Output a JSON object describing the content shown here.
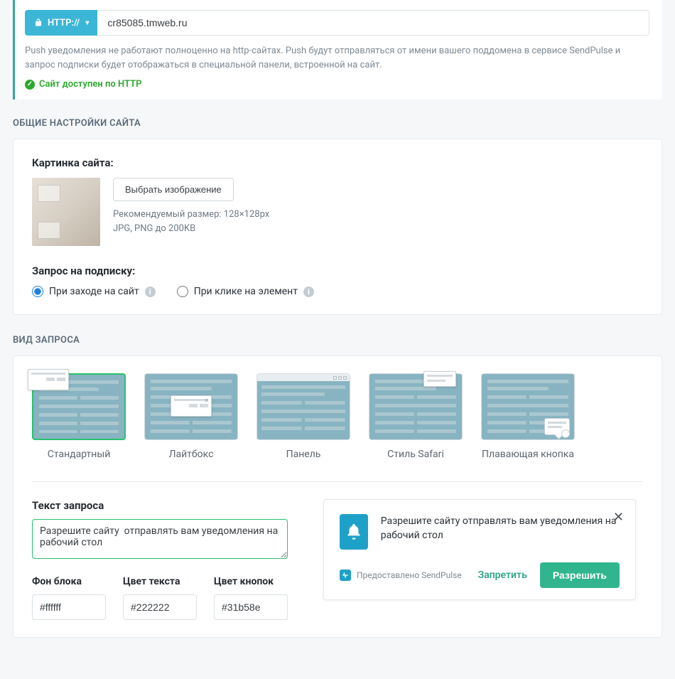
{
  "http": {
    "badge_label": "HTTP://",
    "url": "cr85085.tmweb.ru",
    "note": "Push уведомления не работают полноценно на http-сайтах. Push будут отправляться от имени вашего поддомена в сервисе SendPulse и запрос подписки будет отображаться в специальной панели, встроенной на сайт.",
    "status": "Сайт доступен по HTTP"
  },
  "sections": {
    "general": "ОБЩИЕ НАСТРОЙКИ САЙТА",
    "view": "ВИД ЗАПРОСА"
  },
  "image_block": {
    "heading": "Картинка сайта:",
    "choose_button": "Выбрать изображение",
    "rec_size": "Рекомендуемый размер: 128×128px",
    "rec_filetypes": "JPG, PNG до 200KB"
  },
  "subscribe": {
    "heading": "Запрос на подписку:",
    "opt_onload": "При заходе на сайт",
    "opt_onclick": "При клике на элемент"
  },
  "variants": {
    "standard": "Стандартный",
    "lightbox": "Лайтбокс",
    "panel": "Панель",
    "safari": "Стиль Safari",
    "floating": "Плавающая кнопка"
  },
  "request_text": {
    "label": "Текст запроса",
    "value": "Разрешите сайту  отправлять вам уведомления на рабочий стол"
  },
  "colors": {
    "block_bg_label": "Фон блока",
    "block_bg_value": "#ffffff",
    "text_color_label": "Цвет текста",
    "text_color_value": "#222222",
    "button_color_label": "Цвет кнопок",
    "button_color_value": "#31b58e"
  },
  "notification_preview": {
    "text": "Разрешите сайту отправлять вам уведомления на рабочий стол",
    "provided_by": "Предоставлено SendPulse",
    "deny": "Запретить",
    "allow": "Разрешить"
  }
}
